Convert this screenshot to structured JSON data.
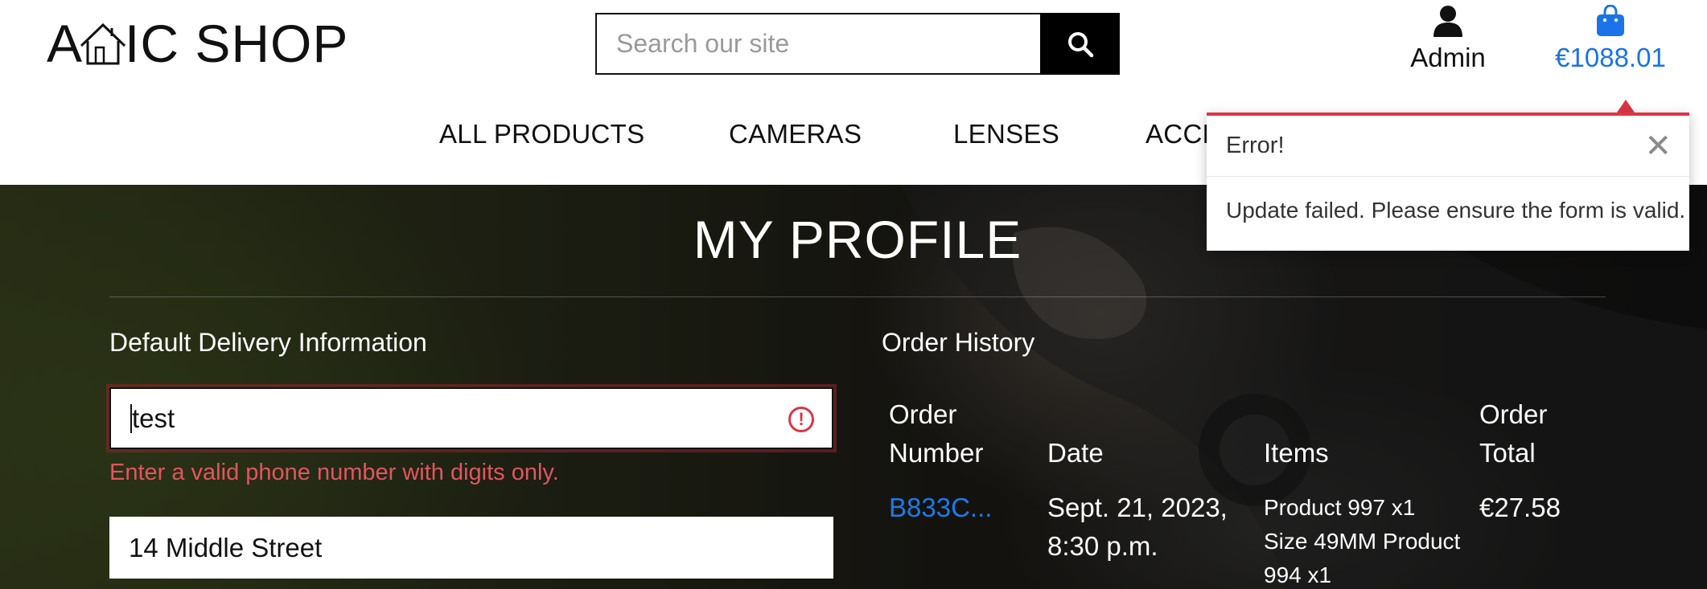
{
  "header": {
    "logo": {
      "left": "A",
      "right": "IC SHOP"
    },
    "search": {
      "placeholder": "Search our site"
    },
    "account": {
      "label": "Admin",
      "icon": "user-icon"
    },
    "cart": {
      "amount": "€1088.01",
      "icon": "shopping-bag-icon",
      "color": "#1a73e8"
    }
  },
  "nav": {
    "items": [
      {
        "label": "ALL PRODUCTS"
      },
      {
        "label": "CAMERAS"
      },
      {
        "label": "LENSES"
      },
      {
        "label": "ACCE"
      }
    ]
  },
  "profile": {
    "title": "MY PROFILE",
    "delivery": {
      "heading": "Default Delivery Information",
      "phone_value": "test",
      "phone_error": "Enter a valid phone number with digits only.",
      "address_value": "14 Middle Street"
    },
    "orders": {
      "heading": "Order History",
      "columns": {
        "number_line1": "Order",
        "number_line2": "Number",
        "date": "Date",
        "items": "Items",
        "total_line1": "Order",
        "total_line2": "Total"
      },
      "rows": [
        {
          "number": "B833C...",
          "date_line1": "Sept. 21, 2023,",
          "date_line2": "8:30 p.m.",
          "items_line1": "Product 997 x1",
          "items_line2": "Size 49MM Product",
          "items_line3": "994 x1",
          "total": "€27.58"
        }
      ]
    }
  },
  "toast": {
    "title": "Error!",
    "message": "Update failed. Please ensure the form is valid.",
    "accent": "#dc3545",
    "close_icon": "close-icon"
  }
}
